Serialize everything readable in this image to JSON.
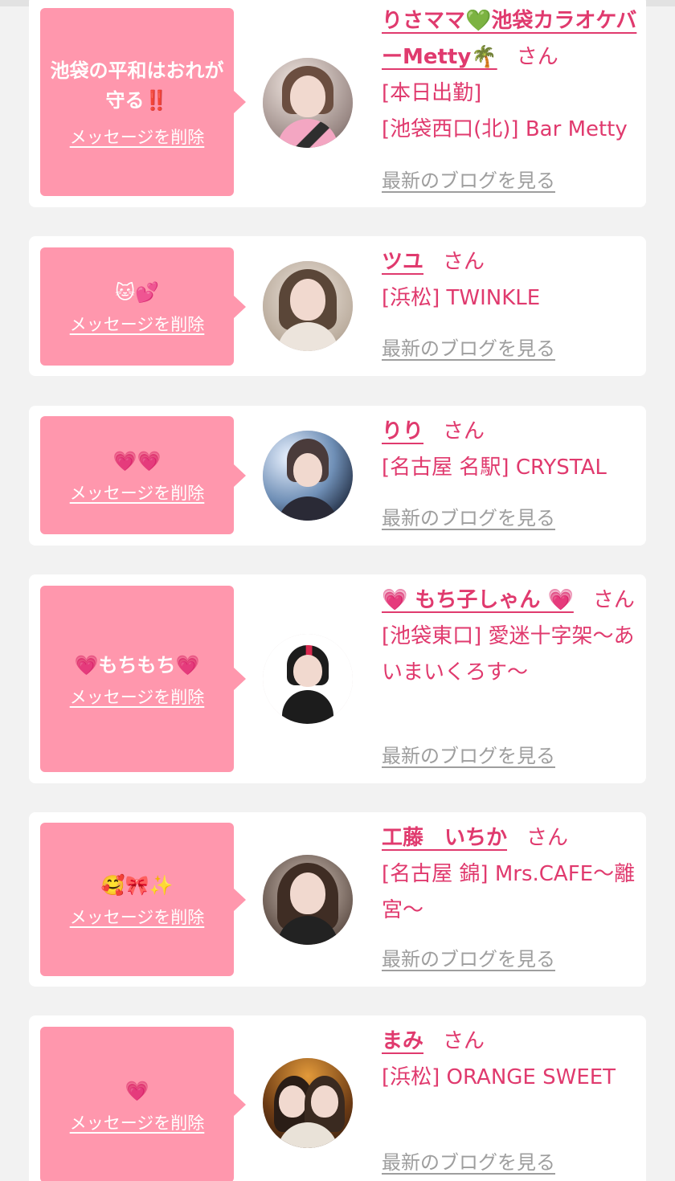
{
  "colors": {
    "accent_pink": "#e03a6e",
    "bubble_pink": "#ff97ad",
    "link_gray": "#9e9e9e",
    "background": "#f2f2f2"
  },
  "entries": [
    {
      "message": "池袋の平和はおれが守る‼️",
      "delete_label": "メッセージを削除",
      "name": "りさママ💚池袋カラオケバーMetty🌴",
      "honorific": "さん",
      "details": [
        "[本日出勤]",
        "[池袋西口(北)] Bar Metty"
      ],
      "blog_label": "最新のブログを見る"
    },
    {
      "message": "🐱💕",
      "delete_label": "メッセージを削除",
      "name": "ツユ",
      "honorific": "さん",
      "details": [
        "[浜松] TWINKLE"
      ],
      "blog_label": "最新のブログを見る"
    },
    {
      "message": "💗💗",
      "delete_label": "メッセージを削除",
      "name": "りり",
      "honorific": "さん",
      "details": [
        "[名古屋 名駅] CRYSTAL"
      ],
      "blog_label": "最新のブログを見る"
    },
    {
      "message": "💗もちもち💗",
      "delete_label": "メッセージを削除",
      "name": "💗 もち子しゃん 💗",
      "honorific": "さん",
      "details": [
        "[池袋東口] 愛迷十字架〜あいまいくろす〜"
      ],
      "blog_label": "最新のブログを見る"
    },
    {
      "message": "🥰🎀✨",
      "delete_label": "メッセージを削除",
      "name": "工藤　いちか",
      "honorific": "さん",
      "details": [
        "[名古屋 錦] Mrs.CAFE〜離宮〜"
      ],
      "blog_label": "最新のブログを見る"
    },
    {
      "message": "💗",
      "delete_label": "メッセージを削除",
      "name": "まみ",
      "honorific": "さん",
      "details": [
        "[浜松] ORANGE SWEET"
      ],
      "blog_label": "最新のブログを見る"
    }
  ]
}
